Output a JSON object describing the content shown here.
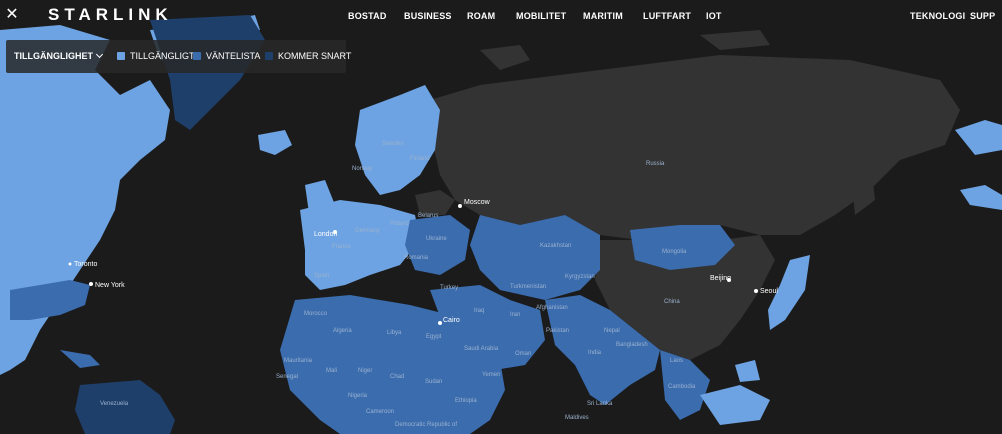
{
  "header": {
    "logo": "STARLINK",
    "nav": [
      "BOSTAD",
      "BUSINESS",
      "ROAM",
      "MOBILITET",
      "MARITIM",
      "LUFTFART",
      "IOT",
      "TEKNOLOGI",
      "SUPP"
    ]
  },
  "legend": {
    "dropdown_label": "TILLGÄNGLIGHET",
    "items": [
      {
        "label": "TILLGÄNGLIGT",
        "color": "#6da3e2"
      },
      {
        "label": "VÄNTELISTA",
        "color": "#3b6cae"
      },
      {
        "label": "KOMMER SNART",
        "color": "#1f3f6b"
      }
    ]
  },
  "colors": {
    "ocean": "#1b1b1b",
    "unavailable_land": "#333333",
    "available": "#6da3e2",
    "waitlist": "#3b6cae",
    "coming_soon": "#1f3f6b"
  },
  "cities": [
    "Toronto",
    "New York",
    "Moscow",
    "Cairo",
    "Beijing",
    "Seoul",
    "London"
  ],
  "regions": [
    "Sweden",
    "Finland",
    "Norway",
    "Germany",
    "France",
    "Spain",
    "Ukraine",
    "Romania",
    "Turkey",
    "Belarus",
    "Poland",
    "Russia",
    "Kazakhstan",
    "Mongolia",
    "China",
    "Kyrgyzstan",
    "Turkmenistan",
    "Iran",
    "Iraq",
    "Afghanistan",
    "Pakistan",
    "India",
    "Nepal",
    "Bangladesh",
    "Laos",
    "Cambodia",
    "Sri Lanka",
    "Maldives",
    "Saudi Arabia",
    "Oman",
    "Yemen",
    "Egypt",
    "Libya",
    "Algeria",
    "Morocco",
    "Mauritania",
    "Mali",
    "Niger",
    "Chad",
    "Sudan",
    "Ethiopia",
    "Senegal",
    "Nigeria",
    "Cameroon",
    "Venezuela",
    "Democratic Republic of"
  ]
}
